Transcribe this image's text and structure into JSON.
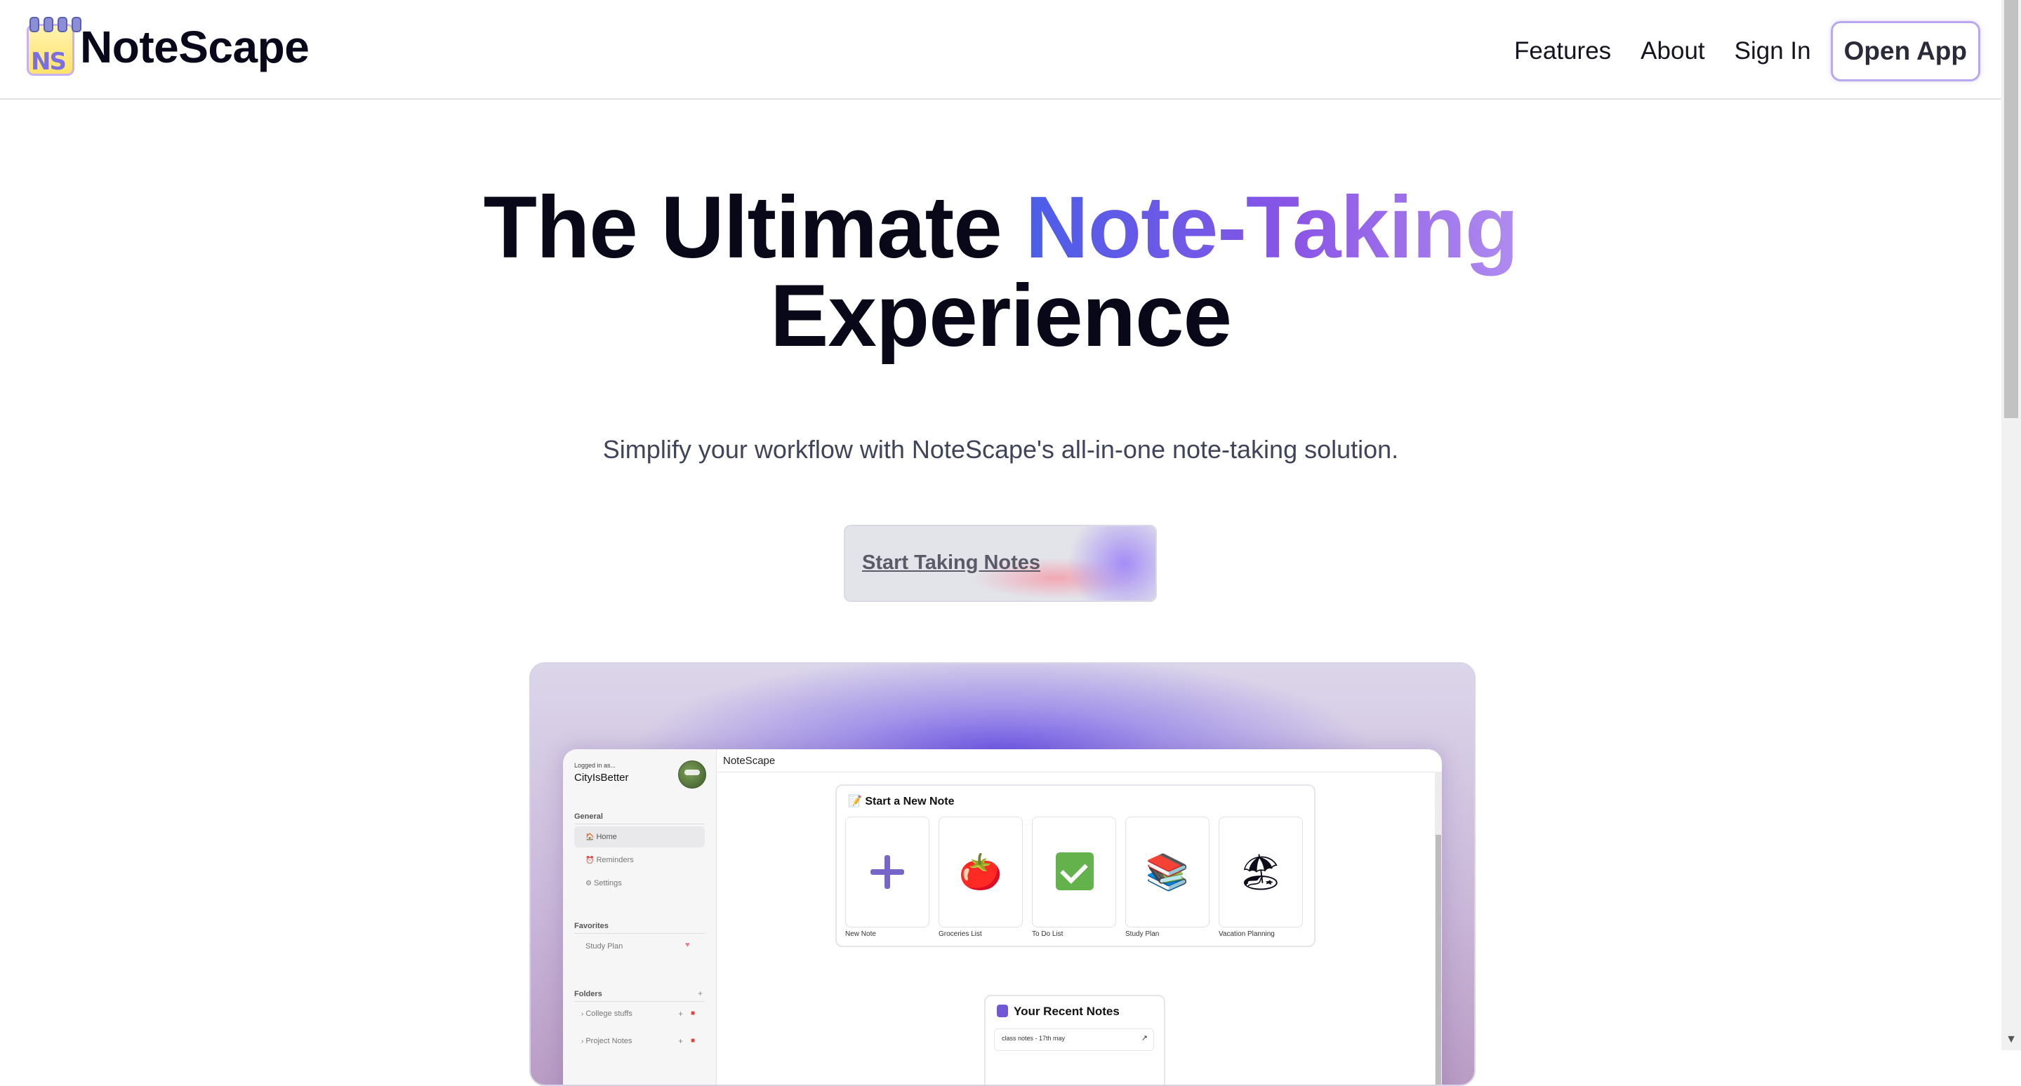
{
  "header": {
    "brand": "NoteScape",
    "logo_letters": "NS",
    "nav": [
      "Features",
      "About",
      "Sign In"
    ],
    "open_app": "Open App"
  },
  "hero": {
    "title_part1": "The Ultimate ",
    "title_highlight": "Note-Taking",
    "title_part2": "Experience",
    "subtitle": "Simplify your workflow with NoteScape's all-in-one note-taking solution.",
    "cta": "Start Taking Notes"
  },
  "preview": {
    "logged_in_label": "Logged in as...",
    "username": "CityIsBetter",
    "app_title": "NoteScape",
    "sections": {
      "general": "General",
      "favorites": "Favorites",
      "folders": "Folders"
    },
    "general_items": [
      {
        "label": "Home",
        "icon": "home-icon"
      },
      {
        "label": "Reminders",
        "icon": "alarm-icon"
      },
      {
        "label": "Settings",
        "icon": "gear-icon"
      }
    ],
    "favorites": [
      "Study Plan"
    ],
    "folders": [
      "College stuffs",
      "Project Notes"
    ],
    "new_note_title": "Start a New Note",
    "templates": [
      {
        "label": "New Note",
        "icon": "plus-icon"
      },
      {
        "label": "Groceries List",
        "icon": "tomato-icon"
      },
      {
        "label": "To Do List",
        "icon": "check-icon"
      },
      {
        "label": "Study Plan",
        "icon": "books-icon"
      },
      {
        "label": "Vacation Planning",
        "icon": "beach-umbrella-icon"
      }
    ],
    "recent_title": "Your Recent Notes",
    "recent_notes": [
      "class notes - 17th may"
    ]
  },
  "colors": {
    "accent_start": "#4a5ee8",
    "accent_end": "#b08cf0",
    "open_app_border": "#b9a7f0"
  }
}
